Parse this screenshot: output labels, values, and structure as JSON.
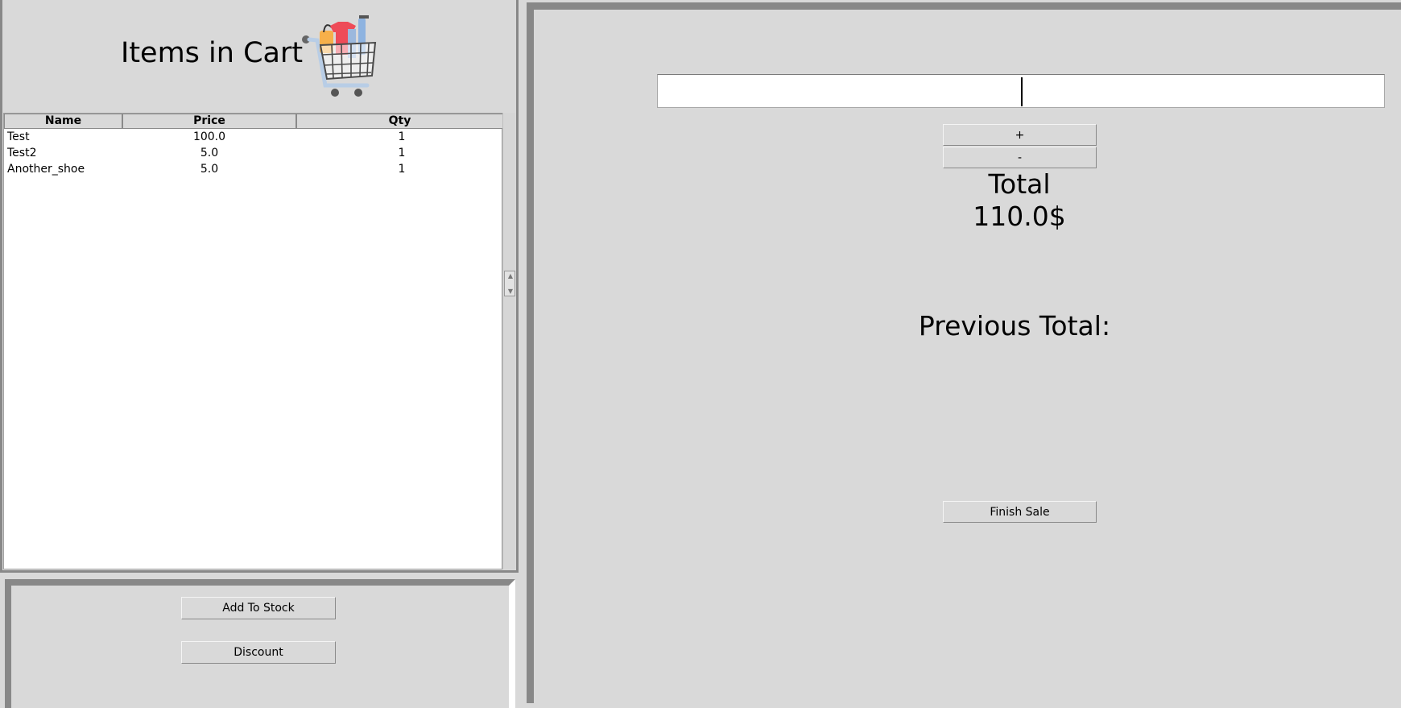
{
  "cart": {
    "title": "Items in Cart",
    "columns": [
      "Name",
      "Price",
      "Qty"
    ],
    "items": [
      {
        "name": "Test",
        "price": "100.0",
        "qty": "1"
      },
      {
        "name": "Test2",
        "price": "5.0",
        "qty": "1"
      },
      {
        "name": "Another_shoe",
        "price": "5.0",
        "qty": "1"
      }
    ]
  },
  "actions": {
    "add_to_stock": "Add To Stock",
    "discount": "Discount"
  },
  "checkout": {
    "barcode_value": "",
    "plus_label": "+",
    "minus_label": "-",
    "total_label": "Total",
    "total_value": "110.0$",
    "previous_total_label": "Previous Total:",
    "finish_sale_label": "Finish Sale"
  },
  "colors": {
    "background": "#d9d9d9",
    "panel_border": "#888888",
    "table_background": "#ffffff"
  }
}
